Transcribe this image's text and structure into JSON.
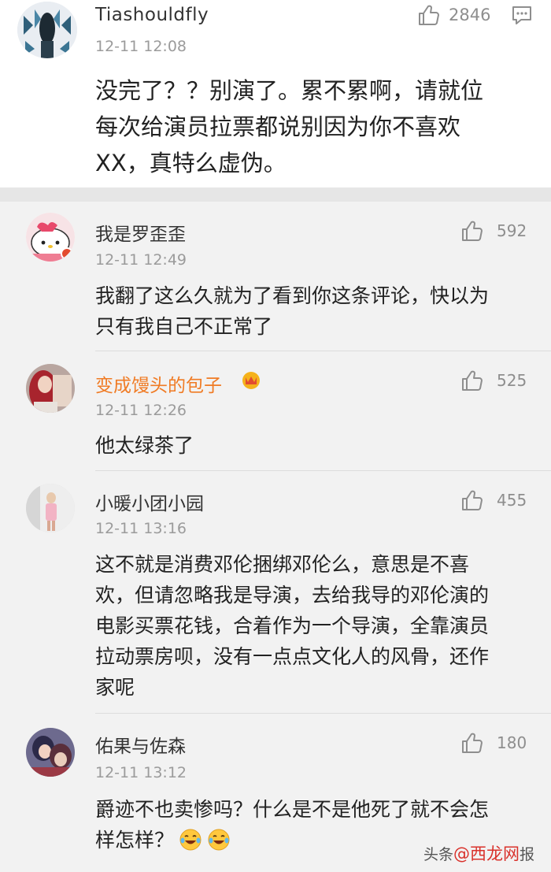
{
  "main_comment": {
    "username": "Tiashouldfly",
    "time": "12-11 12:08",
    "likes": "2846",
    "lines": [
      "没完了？？别演了。累不累啊，请就位",
      "每次给演员拉票都说别因为你不喜欢",
      "XX，真特么虚伪。"
    ]
  },
  "replies": [
    {
      "username": "我是罗歪歪",
      "time": "12-11 12:49",
      "likes": "592",
      "lines": [
        "我翻了这么久就为了看到你这条评论，快以为",
        "只有我自己不正常了"
      ]
    },
    {
      "username": "变成馒头的包子",
      "time": "12-11 12:26",
      "likes": "525",
      "lines": [
        "他太绿茶了"
      ]
    },
    {
      "username": "小暖小团小园",
      "time": "12-11 13:16",
      "likes": "455",
      "lines": [
        "这不就是消费邓伦捆绑邓伦么，意思是不喜",
        "欢，但请忽略我是导演，去给我导的邓伦演的",
        "电影买票花钱，合着作为一个导演，全靠演员",
        "拉动票房呗，没有一点点文化人的风骨，还作",
        "家呢"
      ]
    },
    {
      "username": "佑果与佐森",
      "time": "12-11 13:12",
      "likes": "180",
      "lines": [
        "爵迹不也卖惨吗？什么是不是他死了就不会怎",
        "样怎样？"
      ]
    }
  ],
  "watermark": {
    "prefix": "头条",
    "brand": "@西龙网",
    "suffix": "报"
  },
  "icons": {
    "like": "thumbs-up-icon",
    "reply": "comment-reply-icon",
    "vip": "crown-icon",
    "emoji": "laugh-cry-emoji-icon"
  },
  "colors": {
    "vip_name": "#f07b24",
    "meta_gray": "#9b9b9b",
    "text": "#222222"
  }
}
